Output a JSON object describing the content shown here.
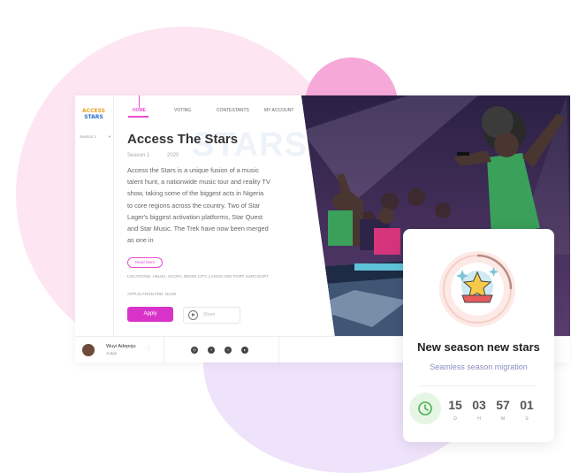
{
  "brand": {
    "line1": "ACCESS",
    "line2": "STARS"
  },
  "sidebar": {
    "season_select": "Season 1"
  },
  "nav": {
    "home": "HOME",
    "voting": "VOTING",
    "contestants": "CONTESTANTS",
    "account": "MY ACCOUNT"
  },
  "hero": {
    "bg_text": "STARS",
    "title": "Access The Stars",
    "season": "Season 1",
    "year": "2020",
    "description": "Access the Stars is a unique fusion of a music talent hunt, a nationwide music tour and reality TV show, taking some of the biggest acts in Nigeria to core regions across the country. Two of Star Lager's biggest activation platforms, Star Quest and Star Music. The Trek have now been merged as one in",
    "read_more": "Read More",
    "locations": "LOCATIONS: ABUJA, ACCRA, BENIN CITY, LAGOS AND PORT HARCOURT",
    "fee": "APPLICATION FEE: N3,00",
    "apply": "Apply",
    "share": "Share"
  },
  "judge": {
    "name": "Wuyi Adepoju",
    "role": "Judge"
  },
  "social_icons": [
    "instagram-icon",
    "facebook-icon",
    "twitter-icon",
    "youtube-icon"
  ],
  "card": {
    "title": "New season new stars",
    "subtitle": "Seamless season migration",
    "countdown": [
      {
        "value": "15",
        "unit": "D"
      },
      {
        "value": "03",
        "unit": "H"
      },
      {
        "value": "57",
        "unit": "M"
      },
      {
        "value": "01",
        "unit": "S"
      }
    ]
  },
  "colors": {
    "accent": "#d733c9",
    "pink_blob": "#fde6f1",
    "lavender_blob": "#efe3fb",
    "clock_green": "#4caf50"
  }
}
